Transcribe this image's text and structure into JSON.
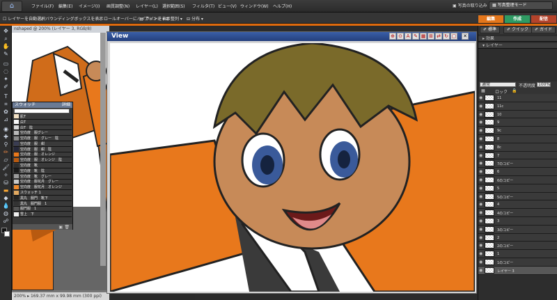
{
  "menubar": {
    "items": [
      "ファイル(F)",
      "編集(E)",
      "イメージ(I)",
      "画質調整(N)",
      "レイヤー(L)",
      "選択範囲(S)",
      "フィルタ(T)",
      "ビュー(V)",
      "ウィンドウ(W)",
      "ヘルプ(H)"
    ],
    "get_photo": "写真の取り込み",
    "organizer": "写真整理モード"
  },
  "options": {
    "auto_select": "レイヤーを自動選択",
    "bounding_box": "バウンディングボックスを表示",
    "rollover": "ロールオーバーにハイライトを表示",
    "arrange": "アレンジ",
    "align": "整列",
    "distribute": "分布"
  },
  "mode_tabs": [
    "編集",
    "作成",
    "配信"
  ],
  "doc1": {
    "title": "nshaped @ 200% (レイヤー 3, RGB/8)",
    "status": "200%",
    "status_size": "169.37 mm x 99.98 mm (300 ppi)"
  },
  "view_window": {
    "title": "View"
  },
  "swatch_panel": {
    "header": "スウォッチ",
    "header_right": "詳細",
    "selected_set": "",
    "items": [
      {
        "name": "肌T",
        "color": "#f3e1c4"
      },
      {
        "name": "白T",
        "color": "#f8f8f8"
      },
      {
        "name": "白T　陰",
        "color": "#d8d8d8"
      },
      {
        "name": "空向度　服グレー",
        "color": "#b8b8b8"
      },
      {
        "name": "空向度　服　グレー　陰",
        "color": "#8a8a8a"
      },
      {
        "name": "空向度　服　紺",
        "color": "#3a3d52"
      },
      {
        "name": "空向度　服　紺　陰",
        "color": "#26283a"
      },
      {
        "name": "空向度　服　オレンジ",
        "color": "#e8781c"
      },
      {
        "name": "空向度　服　オレンジ　陰",
        "color": "#b85a10"
      },
      {
        "name": "空向度　靴",
        "color": "#2e2e2e"
      },
      {
        "name": "空向度　靴　陰",
        "color": "#1a1a1a"
      },
      {
        "name": "空向度　靴　グレー",
        "color": "#9a9a9a"
      },
      {
        "name": "空向度　服花月　グレー",
        "color": "#c8c8c8"
      },
      {
        "name": "空向度　服花月　オレンジ",
        "color": "#f08a2a"
      },
      {
        "name": "スウォッチ 1",
        "color": "#e0a860"
      },
      {
        "name": "黒丸　服門　靴下",
        "color": "#222222"
      },
      {
        "name": "黒丸　服門服　1",
        "color": "#333333"
      },
      {
        "name": "服門服　1",
        "color": "#555555"
      },
      {
        "name": "雪上　下",
        "color": "#eeeeee"
      }
    ]
  },
  "right_panel": {
    "edit_modes": [
      "標準",
      "クイック",
      "ガイド"
    ],
    "effects_header": "効果",
    "layers_header": "レイヤー",
    "blend_mode": "通常",
    "opacity_label": "不透明度",
    "opacity_value": "100%",
    "lock_label": "ロック",
    "layers": [
      {
        "name": "11"
      },
      {
        "name": "11c"
      },
      {
        "name": "10"
      },
      {
        "name": "9"
      },
      {
        "name": "9c"
      },
      {
        "name": "8"
      },
      {
        "name": "8c"
      },
      {
        "name": "7"
      },
      {
        "name": "7のコピー"
      },
      {
        "name": "6"
      },
      {
        "name": "6のコピー"
      },
      {
        "name": "5"
      },
      {
        "name": "5のコピー"
      },
      {
        "name": "4"
      },
      {
        "name": "4のコピー"
      },
      {
        "name": "3"
      },
      {
        "name": "3のコピー"
      },
      {
        "name": "2"
      },
      {
        "name": "2のコピー"
      },
      {
        "name": "1"
      },
      {
        "name": "1のコピー"
      },
      {
        "name": "レイヤー 3"
      }
    ]
  },
  "colors": {
    "accent": "#e06a0c",
    "tab_edit": "#e4761b",
    "tab_create": "#2f9b63",
    "tab_share": "#b4432b"
  }
}
